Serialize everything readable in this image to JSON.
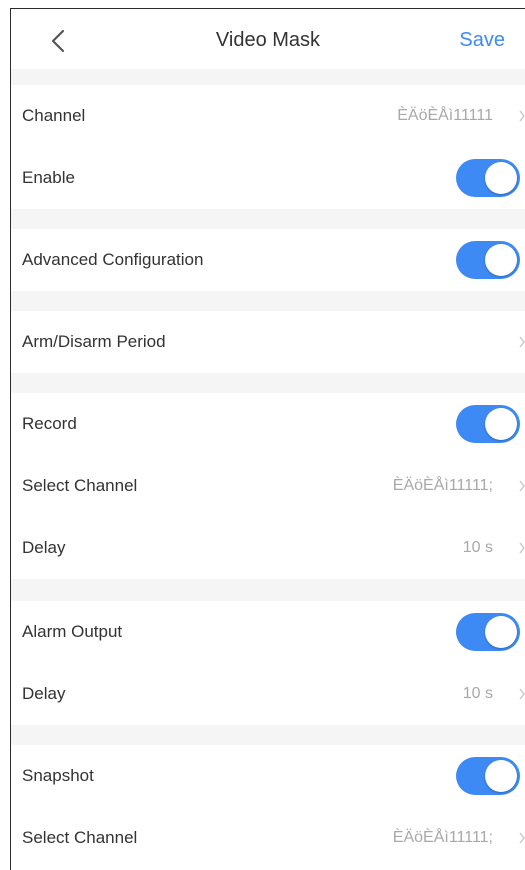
{
  "header": {
    "title": "Video Mask",
    "save_label": "Save",
    "back_icon": "chevron-left-icon"
  },
  "rows": {
    "channel": {
      "label": "Channel",
      "value": "ÈÄöÈÅì11111"
    },
    "enable": {
      "label": "Enable",
      "on": true
    },
    "advanced": {
      "label": "Advanced Configuration",
      "on": true
    },
    "arm_period": {
      "label": "Arm/Disarm Period"
    },
    "record": {
      "label": "Record",
      "on": true
    },
    "record_channel": {
      "label": "Select Channel",
      "value": "ÈÄöÈÅì11111;"
    },
    "record_delay": {
      "label": "Delay",
      "value": "10 s"
    },
    "alarm_output": {
      "label": "Alarm Output",
      "on": true
    },
    "alarm_delay": {
      "label": "Delay",
      "value": "10 s"
    },
    "snapshot": {
      "label": "Snapshot",
      "on": true
    },
    "snapshot_channel": {
      "label": "Select Channel",
      "value": "ÈÄöÈÅì11111;"
    }
  },
  "colors": {
    "accent": "#3d8af5",
    "section_gap": "#f5f5f5",
    "value_text": "#a8a8a8"
  }
}
